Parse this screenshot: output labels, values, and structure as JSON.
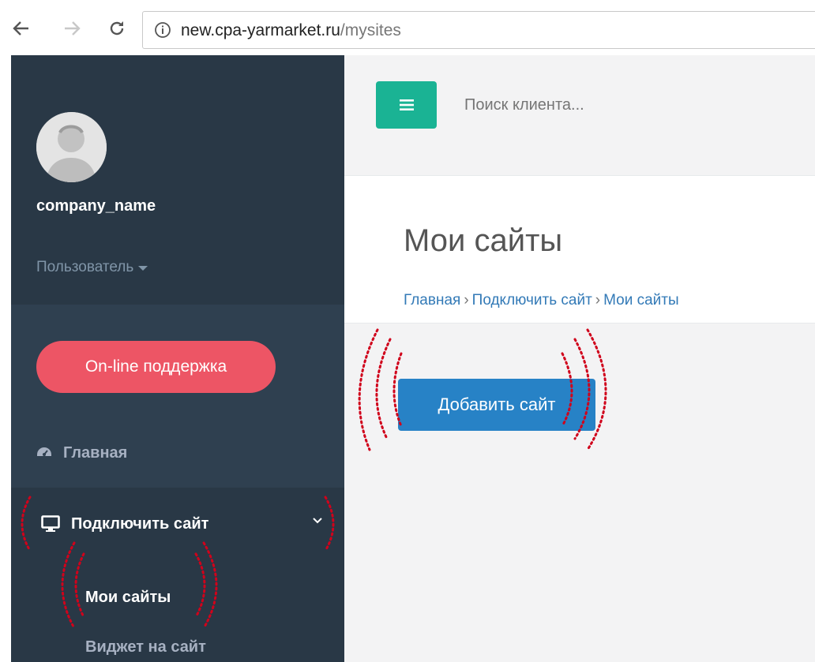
{
  "browser": {
    "url_host": "new.cpa-yarmarket.ru",
    "url_path": "/mysites"
  },
  "sidebar": {
    "company_name": "company_name",
    "role": "Пользователь",
    "support_button": "On-line поддержка",
    "menu": {
      "home": "Главная",
      "connect_site": "Подключить сайт",
      "submenu": [
        "Мои сайты",
        "Виджет на сайт"
      ]
    }
  },
  "header": {
    "search_placeholder": "Поиск клиента..."
  },
  "main": {
    "title": "Мои сайты",
    "breadcrumb": [
      "Главная",
      "Подключить сайт",
      "Мои сайты"
    ],
    "breadcrumb_separator": "›",
    "add_button": "Добавить сайт"
  },
  "colors": {
    "sidebar": "#2f4050",
    "sidebar_dark": "#293846",
    "accent_green": "#1ab394",
    "support_red": "#ed5565",
    "button_blue": "#2782c6",
    "annotation": "#d0021b"
  },
  "icons": [
    "back-arrow-icon",
    "forward-arrow-icon",
    "reload-icon",
    "info-icon",
    "dashboard-icon",
    "desktop-icon",
    "chevron-down-icon",
    "hamburger-icon",
    "caret-down-icon"
  ]
}
